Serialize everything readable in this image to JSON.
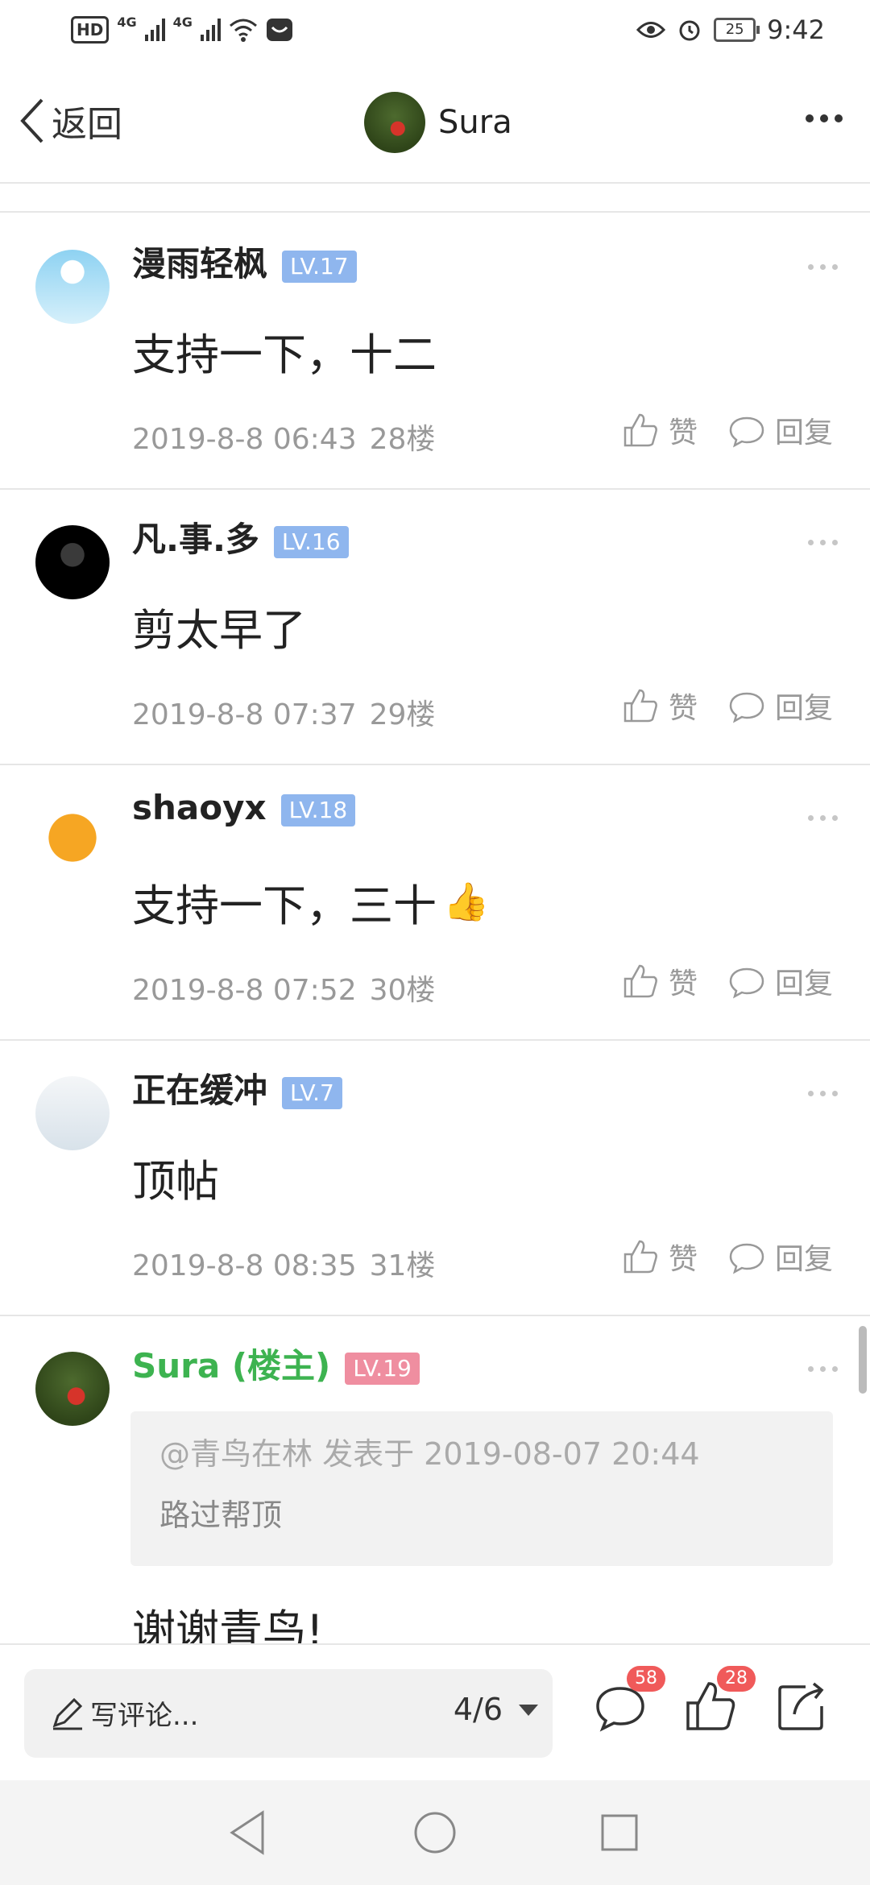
{
  "status_bar": {
    "hd": "HD",
    "net1": "4G",
    "net2": "4G",
    "battery": "25",
    "time": "9:42"
  },
  "header": {
    "back_label": "返回",
    "username": "Sura"
  },
  "comments": [
    {
      "name": "漫雨轻枫",
      "level": "LV.17",
      "text": "支持一下，十二",
      "time": "2019-8-8 06:43",
      "floor": "28楼",
      "like": "赞",
      "reply": "回复"
    },
    {
      "name": "凡.事.多",
      "level": "LV.16",
      "text": "剪太早了",
      "time": "2019-8-8 07:37",
      "floor": "29楼",
      "like": "赞",
      "reply": "回复"
    },
    {
      "name": "shaoyx",
      "level": "LV.18",
      "text": "支持一下，三十",
      "time": "2019-8-8 07:52",
      "floor": "30楼",
      "like": "赞",
      "reply": "回复"
    },
    {
      "name": "正在缓冲",
      "level": "LV.7",
      "text": "顶帖",
      "time": "2019-8-8 08:35",
      "floor": "31楼",
      "like": "赞",
      "reply": "回复"
    }
  ],
  "host_comment": {
    "name": "Sura (楼主)",
    "level": "LV.19",
    "quote_head": "@青鸟在林 发表于 2019-08-07 20:44",
    "quote_body": "路过帮顶",
    "text": "谢谢青鸟!"
  },
  "bottom_bar": {
    "placeholder": "写评论...",
    "page": "4/6",
    "comment_count": "58",
    "like_count": "28"
  },
  "colors": {
    "level_badge": "#8fb6ee",
    "host_badge": "#ef8ea0",
    "host_name": "#3db350",
    "count_badge": "#f05a5a"
  }
}
